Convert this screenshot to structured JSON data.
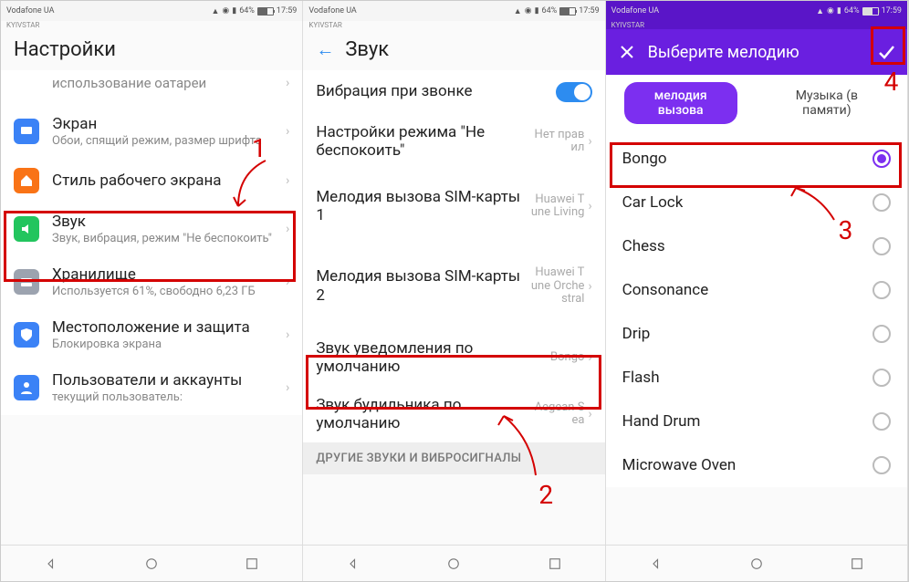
{
  "status": {
    "carrier": "Vodafone UA",
    "subcarrier": "KYIVSTAR",
    "battery": "64%",
    "time": "17:59"
  },
  "p1": {
    "title": "Настройки",
    "rows": {
      "battery_use": "использование оатареи",
      "screen": {
        "t": "Экран",
        "s": "Обои, спящий режим, размер шрифта"
      },
      "homestyle": {
        "t": "Стиль рабочего экрана"
      },
      "sound": {
        "t": "Звук",
        "s": "Звук, вибрация, режим \"Не беспокоить\""
      },
      "storage": {
        "t": "Хранилище",
        "s": "Используется 61%, свободно 6,23 ГБ"
      },
      "location": {
        "t": "Местоположение и защита",
        "s": "Блокировка экрана"
      },
      "users": {
        "t": "Пользователи и аккаунты",
        "s": "текущий пользователь:"
      }
    },
    "annot": "1"
  },
  "p2": {
    "title": "Звук",
    "rows": {
      "vibrate": "Вибрация при звонке",
      "dnd": {
        "t": "Настройки режима \"Не беспокоить\"",
        "v": "Нет правил"
      },
      "sim1": {
        "t": "Мелодия вызова SIM-карты 1",
        "v": "Huawei Tune Living"
      },
      "sim2": {
        "t": "Мелодия вызова SIM-карты 2",
        "v": "Huawei Tune Orchestral"
      },
      "notif": {
        "t": "Звук уведомления по умолчанию",
        "v": "Bongo"
      },
      "alarm": {
        "t": "Звук будильника по умолчанию",
        "v": "Aegean Sea"
      }
    },
    "section": "ДРУГИЕ ЗВУКИ И ВИБРОСИГНАЛЫ",
    "annot": "2"
  },
  "p3": {
    "title": "Выберите мелодию",
    "tabs": {
      "a": "мелодия вызова",
      "b": "Музыка (в памяти)"
    },
    "items": [
      "Bongo",
      "Car Lock",
      "Chess",
      "Consonance",
      "Drip",
      "Flash",
      "Hand Drum",
      "Microwave Oven"
    ],
    "annot3": "3",
    "annot4": "4"
  }
}
